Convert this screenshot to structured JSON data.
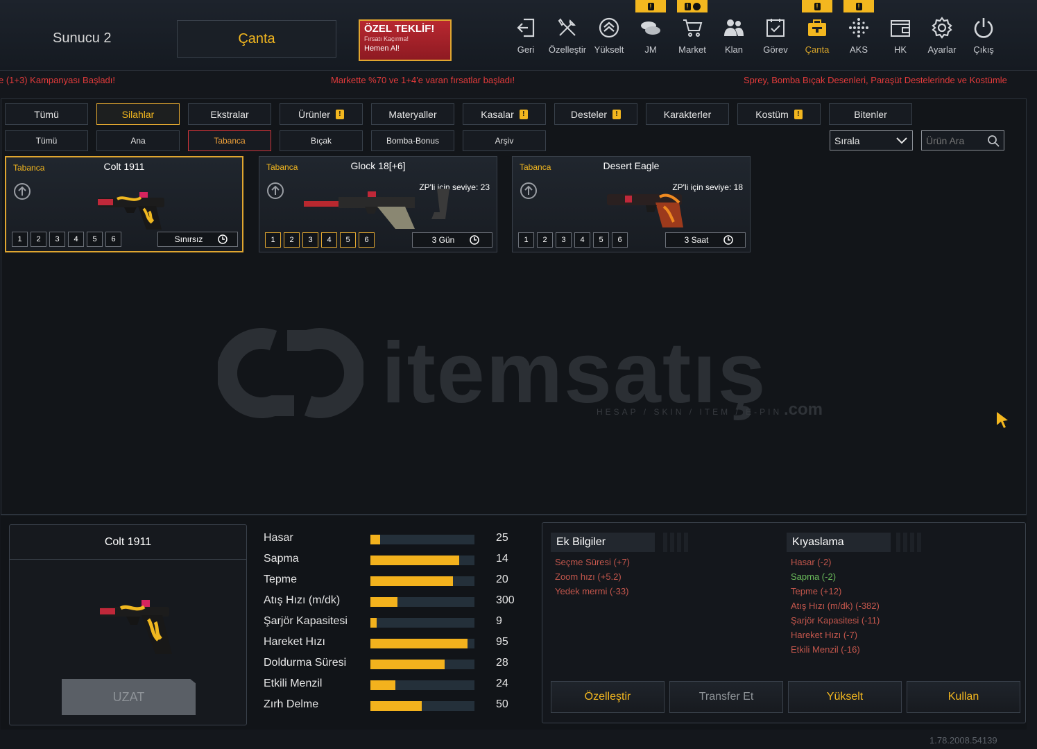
{
  "header": {
    "server": "Sunucu 2",
    "active_tab": "Çanta",
    "offer": {
      "title": "ÖZEL TEKLİF!",
      "subtitle": "Fırsatı Kaçırma!",
      "cta": "Hemen Al!"
    },
    "nav": [
      {
        "label": "Geri",
        "icon": "back-icon",
        "badge": ""
      },
      {
        "label": "Özelleştir",
        "icon": "tools-icon",
        "badge": ""
      },
      {
        "label": "Yükselt",
        "icon": "rank-up-icon",
        "badge": ""
      },
      {
        "label": "JM",
        "icon": "coins-icon",
        "badge": "!"
      },
      {
        "label": "Market",
        "icon": "cart-icon",
        "badge": "! clock"
      },
      {
        "label": "Klan",
        "icon": "clan-icon",
        "badge": ""
      },
      {
        "label": "Görev",
        "icon": "task-icon",
        "badge": ""
      },
      {
        "label": "Çanta",
        "icon": "bag-gun-icon",
        "badge": "!"
      },
      {
        "label": "AKS",
        "icon": "dots-icon",
        "badge": "!"
      },
      {
        "label": "HK",
        "icon": "wallet-icon",
        "badge": ""
      },
      {
        "label": "Ayarlar",
        "icon": "gear-icon",
        "badge": ""
      },
      {
        "label": "Çıkış",
        "icon": "power-icon",
        "badge": ""
      }
    ]
  },
  "ticker": {
    "left": "e (1+3) Kampanyası Başladı!",
    "center": "Markette %70 ve 1+4'e varan fırsatlar başladı!",
    "right": "Sprey, Bomba Bıçak Desenleri, Paraşüt Destelerinde ve Kostümle"
  },
  "categories": [
    {
      "label": "Tümü",
      "warn": false,
      "active": false
    },
    {
      "label": "Silahlar",
      "warn": false,
      "active": true
    },
    {
      "label": "Ekstralar",
      "warn": false,
      "active": false
    },
    {
      "label": "Ürünler",
      "warn": true,
      "active": false
    },
    {
      "label": "Materyaller",
      "warn": false,
      "active": false
    },
    {
      "label": "Kasalar",
      "warn": true,
      "active": false
    },
    {
      "label": "Desteler",
      "warn": true,
      "active": false
    },
    {
      "label": "Karakterler",
      "warn": false,
      "active": false
    },
    {
      "label": "Kostüm",
      "warn": true,
      "active": false
    },
    {
      "label": "Bitenler",
      "warn": false,
      "active": false
    }
  ],
  "subcategories": [
    {
      "label": "Tümü",
      "active": false
    },
    {
      "label": "Ana",
      "active": false
    },
    {
      "label": "Tabanca",
      "active": true
    },
    {
      "label": "Bıçak",
      "active": false
    },
    {
      "label": "Bomba-Bonus",
      "active": false
    },
    {
      "label": "Arşiv",
      "active": false
    }
  ],
  "sort": {
    "label": "Sırala"
  },
  "search": {
    "placeholder": "Ürün Ara"
  },
  "items": [
    {
      "category": "Tabanca",
      "name": "Colt 1911",
      "level": "",
      "slots": [
        "1",
        "2",
        "3",
        "4",
        "5",
        "6"
      ],
      "time": "Sınırsız",
      "selected": true,
      "gold_slots": false
    },
    {
      "category": "Tabanca",
      "name": "Glock 18[+6]",
      "level": "ZP'li için seviye: 23",
      "slots": [
        "1",
        "2",
        "3",
        "4",
        "5",
        "6"
      ],
      "time": "3 Gün",
      "selected": false,
      "gold_slots": true
    },
    {
      "category": "Tabanca",
      "name": "Desert Eagle",
      "level": "ZP'li için seviye: 18",
      "slots": [
        "1",
        "2",
        "3",
        "4",
        "5",
        "6"
      ],
      "time": "3 Saat",
      "selected": false,
      "gold_slots": false
    }
  ],
  "watermark": {
    "brand": "itemsatış",
    "tagline": "HESAP / SKIN / ITEM / E-PIN",
    "domain": ".com"
  },
  "preview": {
    "title": "Colt 1911",
    "uzat_label": "UZAT"
  },
  "stats": [
    {
      "label": "Hasar",
      "value": "25",
      "fill": 0.09
    },
    {
      "label": "Sapma",
      "value": "14",
      "fill": 0.85
    },
    {
      "label": "Tepme",
      "value": "20",
      "fill": 0.79
    },
    {
      "label": "Atış Hızı (m/dk)",
      "value": "300",
      "fill": 0.26
    },
    {
      "label": "Şarjör Kapasitesi",
      "value": "9",
      "fill": 0.06
    },
    {
      "label": "Hareket Hızı",
      "value": "95",
      "fill": 0.93
    },
    {
      "label": "Doldurma Süresi",
      "value": "28",
      "fill": 0.71
    },
    {
      "label": "Etkili Menzil",
      "value": "24",
      "fill": 0.24
    },
    {
      "label": "Zırh Delme",
      "value": "50",
      "fill": 0.49
    }
  ],
  "extra_info": {
    "title": "Ek Bilgiler",
    "lines": [
      {
        "text": "Seçme Süresi (+7)",
        "tone": "neg"
      },
      {
        "text": "Zoom hızı (+5.2)",
        "tone": "neg"
      },
      {
        "text": "Yedek mermi (-33)",
        "tone": "neg"
      }
    ]
  },
  "comparison": {
    "title": "Kıyaslama",
    "lines": [
      {
        "text": "Hasar (-2)",
        "tone": "neg"
      },
      {
        "text": "Sapma (-2)",
        "tone": "pos"
      },
      {
        "text": "Tepme (+12)",
        "tone": "neg"
      },
      {
        "text": "Atış Hızı (m/dk) (-382)",
        "tone": "neg"
      },
      {
        "text": "Şarjör Kapasitesi (-11)",
        "tone": "neg"
      },
      {
        "text": "Hareket Hızı (-7)",
        "tone": "neg"
      },
      {
        "text": "Etkili Menzil (-16)",
        "tone": "neg"
      }
    ]
  },
  "actions": [
    {
      "label": "Özelleştir",
      "tone": "gold"
    },
    {
      "label": "Transfer Et",
      "tone": "grey"
    },
    {
      "label": "Yükselt",
      "tone": "gold"
    },
    {
      "label": "Kullan",
      "tone": "gold"
    }
  ],
  "version": "1.78.2008.54139",
  "colors": {
    "accent": "#f3b71f",
    "negative": "#c3564c",
    "positive": "#6bbd5b",
    "alert": "#e43b3b"
  }
}
